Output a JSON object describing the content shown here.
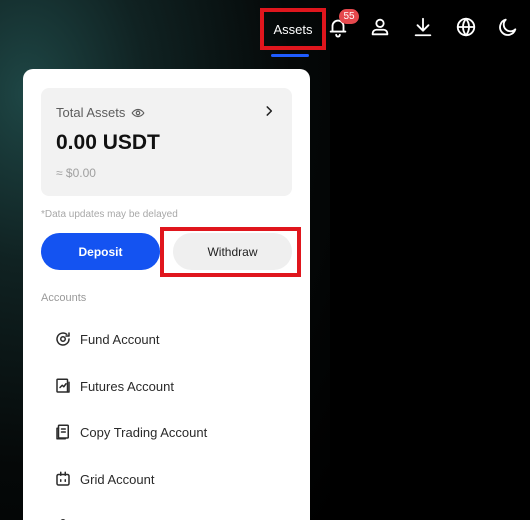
{
  "nav": {
    "assets_label": "Assets",
    "notification_count": "55",
    "icons": [
      "bell-icon",
      "user-icon",
      "download-icon",
      "globe-icon",
      "moon-icon"
    ],
    "accent": "#1f5cff"
  },
  "assets_panel": {
    "total_label": "Total Assets",
    "total_value": "0.00 USDT",
    "fiat_value": "≈ $0.00",
    "note": "*Data updates may be delayed",
    "deposit_label": "Deposit",
    "withdraw_label": "Withdraw",
    "accounts_heading": "Accounts",
    "accounts": [
      {
        "label": "Fund Account",
        "icon": "fund-icon"
      },
      {
        "label": "Futures Account",
        "icon": "futures-icon"
      },
      {
        "label": "Copy Trading Account",
        "icon": "copy-trading-icon"
      },
      {
        "label": "Grid Account",
        "icon": "grid-icon"
      }
    ]
  },
  "colors": {
    "deposit_bg": "#1453f1",
    "highlight": "#e0161d",
    "badge": "#e5484d"
  }
}
